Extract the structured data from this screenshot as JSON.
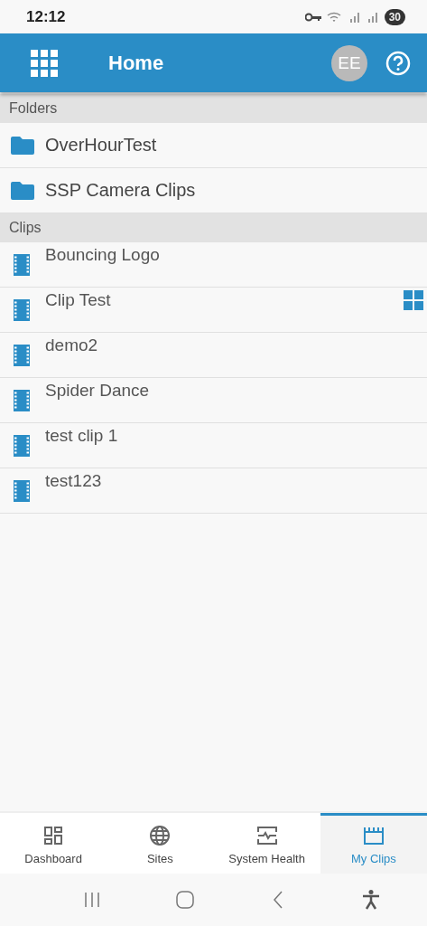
{
  "status_bar": {
    "time": "12:12",
    "battery": "30"
  },
  "header": {
    "title": "Home",
    "avatar": "EE"
  },
  "sections": [
    {
      "title": "Folders",
      "kind": "folder",
      "items": [
        {
          "name": "OverHourTest",
          "grid_icon": false
        },
        {
          "name": "SSP Camera Clips",
          "grid_icon": false
        }
      ]
    },
    {
      "title": "Clips",
      "kind": "clip",
      "items": [
        {
          "name": "Bouncing Logo",
          "grid_icon": false
        },
        {
          "name": "Clip Test",
          "grid_icon": true
        },
        {
          "name": "demo2",
          "grid_icon": false
        },
        {
          "name": "Spider Dance",
          "grid_icon": false
        },
        {
          "name": "test clip 1",
          "grid_icon": false
        },
        {
          "name": "test123",
          "grid_icon": false
        }
      ]
    }
  ],
  "bottom_nav": [
    {
      "label": "Dashboard",
      "kind": "dashboard",
      "selected": false
    },
    {
      "label": "Sites",
      "kind": "globe",
      "selected": false
    },
    {
      "label": "System Health",
      "kind": "health",
      "selected": false
    },
    {
      "label": "My Clips",
      "kind": "clips",
      "selected": true
    }
  ]
}
